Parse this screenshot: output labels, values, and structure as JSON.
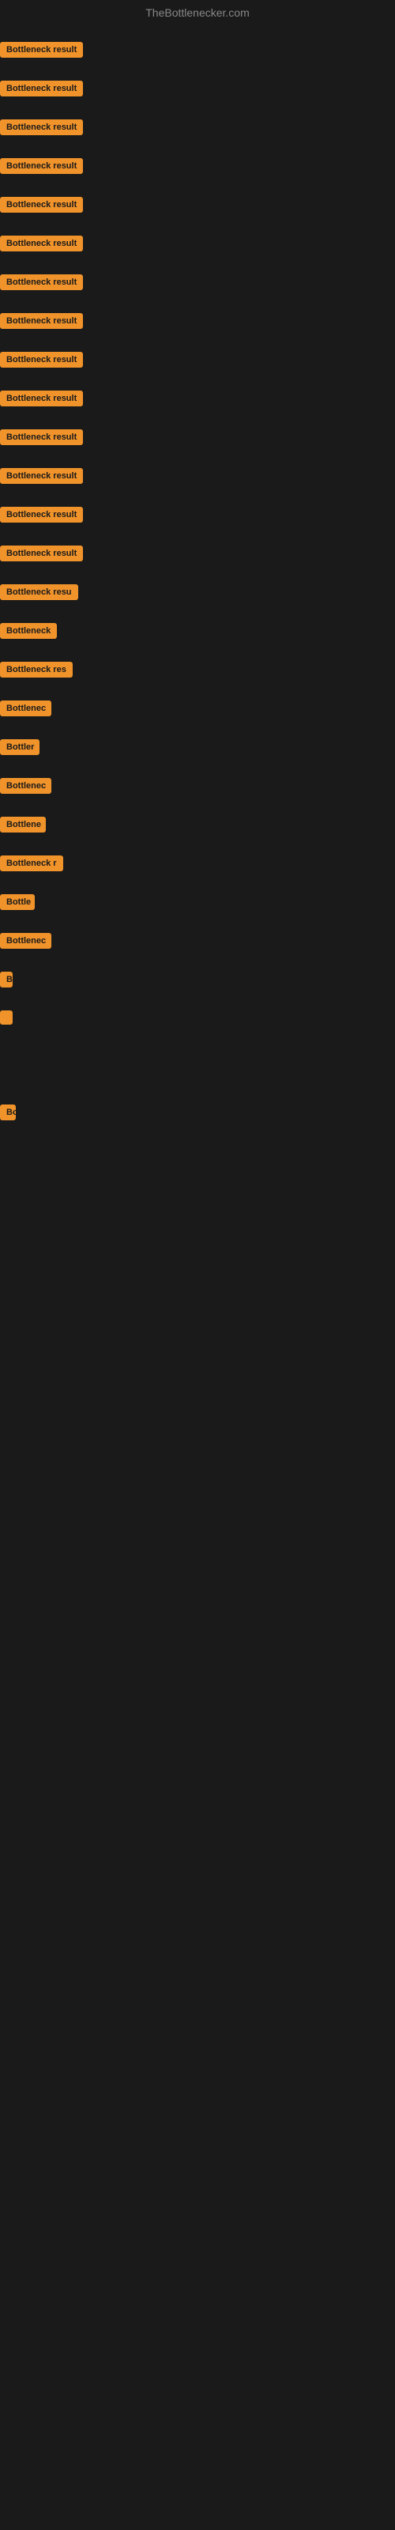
{
  "header": {
    "title": "TheBottlenecker.com"
  },
  "items": [
    {
      "label": "Bottleneck result",
      "width": 110
    },
    {
      "label": "Bottleneck result",
      "width": 110
    },
    {
      "label": "Bottleneck result",
      "width": 110
    },
    {
      "label": "Bottleneck result",
      "width": 110
    },
    {
      "label": "Bottleneck result",
      "width": 110
    },
    {
      "label": "Bottleneck result",
      "width": 110
    },
    {
      "label": "Bottleneck result",
      "width": 110
    },
    {
      "label": "Bottleneck result",
      "width": 110
    },
    {
      "label": "Bottleneck result",
      "width": 110
    },
    {
      "label": "Bottleneck result",
      "width": 110
    },
    {
      "label": "Bottleneck result",
      "width": 110
    },
    {
      "label": "Bottleneck result",
      "width": 110
    },
    {
      "label": "Bottleneck result",
      "width": 110
    },
    {
      "label": "Bottleneck result",
      "width": 110
    },
    {
      "label": "Bottleneck resu",
      "width": 100
    },
    {
      "label": "Bottleneck",
      "width": 72
    },
    {
      "label": "Bottleneck res",
      "width": 92
    },
    {
      "label": "Bottlenec",
      "width": 65
    },
    {
      "label": "Bottler",
      "width": 50
    },
    {
      "label": "Bottlenec",
      "width": 65
    },
    {
      "label": "Bottlene",
      "width": 58
    },
    {
      "label": "Bottleneck r",
      "width": 80
    },
    {
      "label": "Bottle",
      "width": 44
    },
    {
      "label": "Bottlenec",
      "width": 65
    },
    {
      "label": "B",
      "width": 16
    },
    {
      "label": "",
      "width": 8
    },
    {
      "label": "",
      "width": 0
    },
    {
      "label": "",
      "width": 0
    },
    {
      "label": "",
      "width": 0
    },
    {
      "label": "Bo",
      "width": 20
    },
    {
      "label": "",
      "width": 0
    },
    {
      "label": "",
      "width": 0
    },
    {
      "label": "",
      "width": 0
    }
  ]
}
